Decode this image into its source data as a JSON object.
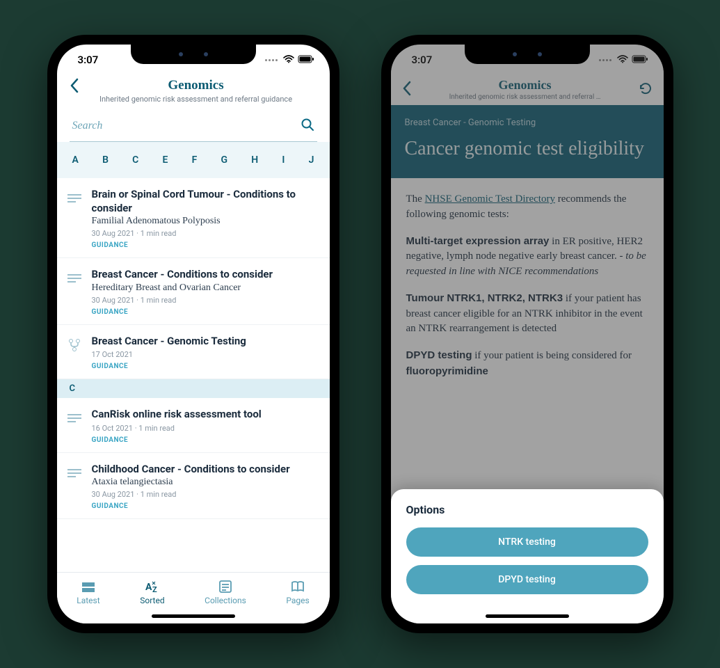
{
  "status": {
    "time": "3:07"
  },
  "left": {
    "header": {
      "title": "Genomics",
      "subtitle": "Inherited genomic risk assessment and referral guidance"
    },
    "search_placeholder": "Search",
    "alpha": [
      "A",
      "B",
      "C",
      "E",
      "F",
      "G",
      "H",
      "I",
      "J"
    ],
    "items": [
      {
        "title": "Brain or Spinal Cord Tumour - Conditions to consider",
        "subtitle": "Familial Adenomatous Polyposis",
        "meta": "30 Aug 2021 · 1 min read",
        "tag": "GUIDANCE",
        "iconType": "lines"
      },
      {
        "title": "Breast Cancer - Conditions to consider",
        "subtitle": "Hereditary Breast and Ovarian Cancer",
        "meta": "30 Aug 2021 · 1 min read",
        "tag": "GUIDANCE",
        "iconType": "lines"
      },
      {
        "title": "Breast Cancer - Genomic Testing",
        "subtitle": "",
        "meta": "17 Oct 2021",
        "tag": "GUIDANCE",
        "iconType": "fork"
      }
    ],
    "section_letter": "C",
    "items2": [
      {
        "title": "CanRisk online risk assessment tool",
        "subtitle": "",
        "meta": "16 Oct 2021 · 1 min read",
        "tag": "GUIDANCE",
        "iconType": "lines"
      },
      {
        "title": "Childhood Cancer - Conditions to consider",
        "subtitle": "Ataxia telangiectasia",
        "meta": "30 Aug 2021 · 1 min read",
        "tag": "GUIDANCE",
        "iconType": "lines"
      }
    ],
    "tabs": [
      {
        "label": "Latest"
      },
      {
        "label": "Sorted"
      },
      {
        "label": "Collections"
      },
      {
        "label": "Pages"
      }
    ]
  },
  "right": {
    "header": {
      "title": "Genomics",
      "subtitle": "Inherited genomic risk assessment and referral …"
    },
    "banner": {
      "crumb": "Breast Cancer - Genomic Testing",
      "title": "Cancer genomic test eligibility"
    },
    "article": {
      "intro_prefix": "The ",
      "intro_link": "NHSE Genomic Test Directory",
      "intro_suffix": " recommends the following genomic tests:",
      "p1_bold": "Multi-target expression array",
      "p1_rest": " in ER positive, HER2 negative, lymph node negative early breast cancer. - ",
      "p1_em": "to be requested in line with NICE recommendations",
      "p2_bold": "Tumour NTRK1, NTRK2, NTRK3",
      "p2_rest": " if your patient has breast cancer eligible for an NTRK inhibitor in the event an NTRK rearrangement is detected",
      "p3_bold": "DPYD testing",
      "p3_mid": " if your patient is being considered for ",
      "p3_bold2": "fluoropyrimidine"
    },
    "sheet": {
      "title": "Options",
      "buttons": [
        "NTRK testing",
        "DPYD testing"
      ]
    }
  }
}
